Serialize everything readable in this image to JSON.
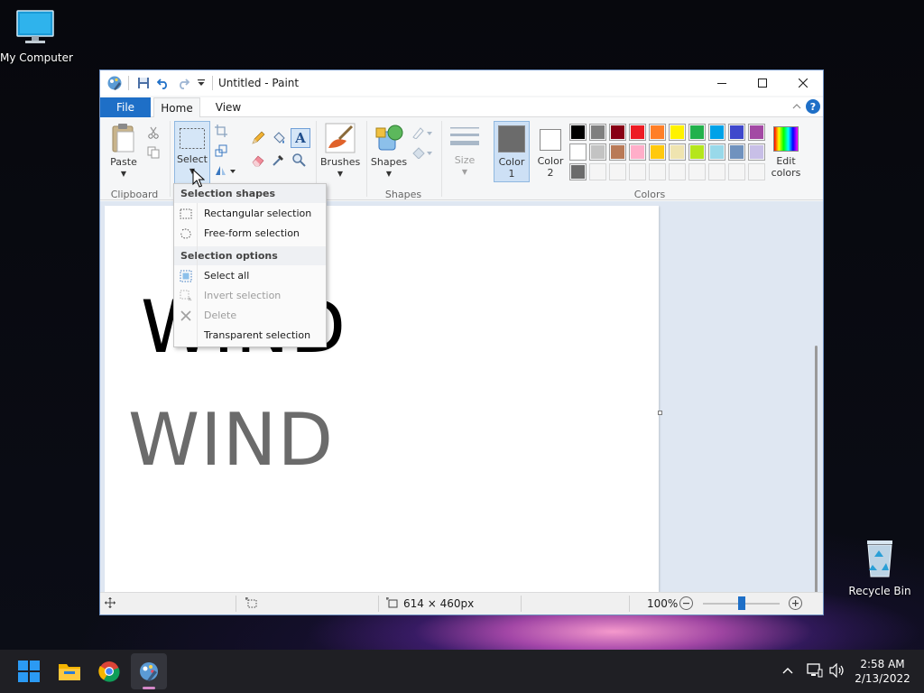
{
  "desktop": {
    "icons": [
      {
        "label": "My Computer"
      },
      {
        "label": "Recycle Bin"
      }
    ]
  },
  "window": {
    "title": "Untitled - Paint",
    "tabs": {
      "file": "File",
      "home": "Home",
      "view": "View"
    },
    "help": "?"
  },
  "ribbon": {
    "clipboard": {
      "paste": "Paste",
      "group": "Clipboard"
    },
    "image": {
      "select": "Select"
    },
    "brushes": "Brushes",
    "shapes": {
      "label": "Shapes",
      "group": "Shapes"
    },
    "size": "Size",
    "color1": {
      "line1": "Color",
      "line2": "1",
      "value": "#6b6b6b"
    },
    "color2": {
      "line1": "Color",
      "line2": "2",
      "value": "#ffffff"
    },
    "edit_colors": {
      "line1": "Edit",
      "line2": "colors"
    },
    "colors_group": "Colors",
    "palette": [
      [
        "#000000",
        "#7f7f7f",
        "#880015",
        "#ed1c24",
        "#ff7f27",
        "#fff200",
        "#22b14c",
        "#00a2e8",
        "#3f48cc",
        "#a349a4"
      ],
      [
        "#ffffff",
        "#c3c3c3",
        "#b97a57",
        "#ffaec9",
        "#ffc90e",
        "#efe4b0",
        "#b5e61d",
        "#99d9ea",
        "#7092be",
        "#c8bfe7"
      ],
      [
        "#6b6b6b",
        "#f5f5f5",
        "#f5f5f5",
        "#f5f5f5",
        "#f5f5f5",
        "#f5f5f5",
        "#f5f5f5",
        "#f5f5f5",
        "#f5f5f5",
        "#f5f5f5"
      ]
    ]
  },
  "select_menu": {
    "heading_shapes": "Selection shapes",
    "rect": "Rectangular selection",
    "freeform": "Free-form selection",
    "heading_options": "Selection options",
    "select_all": "Select all",
    "invert": "Invert selection",
    "delete": "Delete",
    "transparent": "Transparent selection"
  },
  "canvas": {
    "text1": "WIND",
    "text1_color": "#000000",
    "text2": "WIND",
    "text2_color": "#6b6b6b"
  },
  "statusbar": {
    "dimensions": "614 × 460px",
    "zoom": "100%",
    "zoom_level": 100
  },
  "taskbar": {
    "time": "2:58 AM",
    "date": "2/13/2022"
  }
}
